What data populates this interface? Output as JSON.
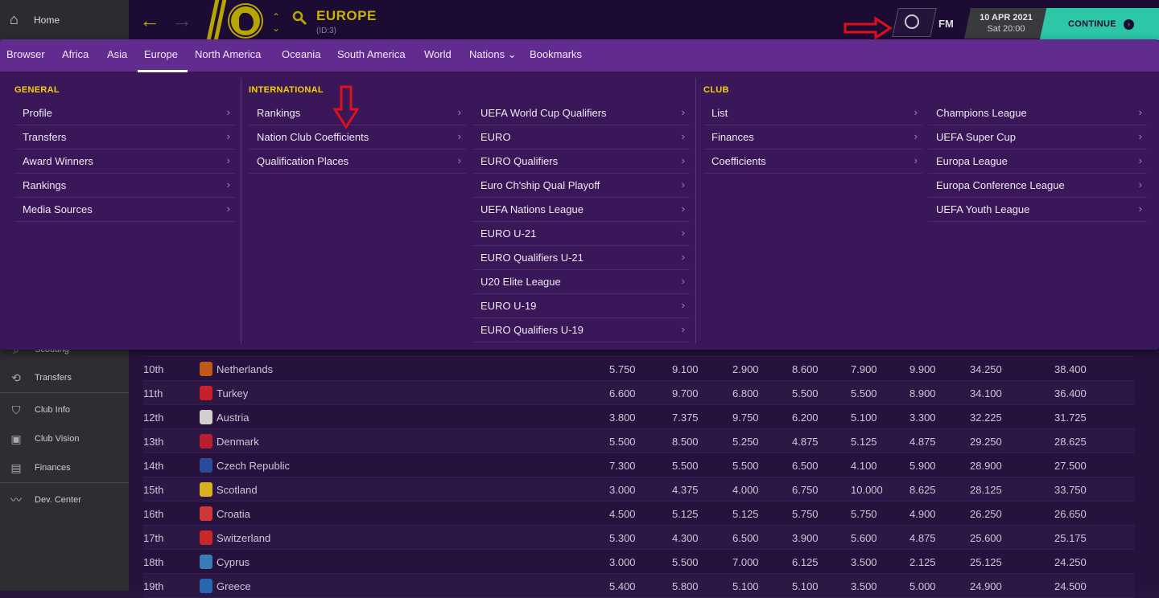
{
  "home": {
    "label": "Home",
    "icon": "home-icon"
  },
  "header": {
    "title": "EUROPE",
    "id_label": "(ID:3)",
    "fm_label": "FM",
    "date": "10 APR 2021",
    "time": "Sat 20:00",
    "continue_label": "CONTINUE"
  },
  "tabs": [
    {
      "label": "Browser"
    },
    {
      "label": "Africa"
    },
    {
      "label": "Asia"
    },
    {
      "label": "Europe",
      "active": true
    },
    {
      "label": "North America"
    },
    {
      "label": "Oceania"
    },
    {
      "label": "South America"
    },
    {
      "label": "World"
    },
    {
      "label": "Nations ⌄"
    },
    {
      "label": "Bookmarks"
    }
  ],
  "menu": {
    "general": {
      "heading": "GENERAL",
      "items": [
        "Profile",
        "Transfers",
        "Award Winners",
        "Rankings",
        "Media Sources"
      ]
    },
    "international": {
      "heading": "INTERNATIONAL",
      "items": [
        "Rankings",
        "Nation Club Coefficients",
        "Qualification Places"
      ]
    },
    "competitions": {
      "items": [
        "UEFA World Cup Qualifiers",
        "EURO",
        "EURO Qualifiers",
        "Euro Ch'ship Qual Playoff",
        "UEFA Nations League",
        "EURO U-21",
        "EURO Qualifiers U-21",
        "U20 Elite League",
        "EURO U-19",
        "EURO Qualifiers U-19"
      ]
    },
    "club": {
      "heading": "CLUB",
      "items": [
        "List",
        "Finances",
        "Coefficients"
      ]
    },
    "club_comps": {
      "items": [
        "Champions League",
        "UEFA Super Cup",
        "Europa League",
        "Europa Conference League",
        "UEFA Youth League"
      ]
    }
  },
  "sidebar": {
    "items": [
      {
        "label": "Scouting",
        "icon": "magnifier-icon"
      },
      {
        "label": "Transfers",
        "icon": "transfer-arrows-icon"
      },
      {
        "label": "Club Info",
        "icon": "shield-icon"
      },
      {
        "label": "Club Vision",
        "icon": "briefcase-icon"
      },
      {
        "label": "Finances",
        "icon": "banknote-icon"
      },
      {
        "label": "Dev. Center",
        "icon": "trend-line-icon"
      }
    ]
  },
  "table": {
    "rows": [
      {
        "rank": "10th",
        "nation": "Netherlands",
        "flag": "#c0581a",
        "values": [
          "5.750",
          "9.100",
          "2.900",
          "8.600",
          "7.900",
          "9.900",
          "34.250",
          "38.400"
        ]
      },
      {
        "rank": "11th",
        "nation": "Turkey",
        "flag": "#c8202a",
        "values": [
          "6.600",
          "9.700",
          "6.800",
          "5.500",
          "5.500",
          "8.900",
          "34.100",
          "36.400"
        ]
      },
      {
        "rank": "12th",
        "nation": "Austria",
        "flag": "#d0d0d0",
        "values": [
          "3.800",
          "7.375",
          "9.750",
          "6.200",
          "5.100",
          "3.300",
          "32.225",
          "31.725"
        ]
      },
      {
        "rank": "13th",
        "nation": "Denmark",
        "flag": "#b82030",
        "values": [
          "5.500",
          "8.500",
          "5.250",
          "4.875",
          "5.125",
          "4.875",
          "29.250",
          "28.625"
        ]
      },
      {
        "rank": "14th",
        "nation": "Czech Republic",
        "flag": "#2a4a9a",
        "values": [
          "7.300",
          "5.500",
          "5.500",
          "6.500",
          "4.100",
          "5.900",
          "28.900",
          "27.500"
        ]
      },
      {
        "rank": "15th",
        "nation": "Scotland",
        "flag": "#d8b020",
        "values": [
          "3.000",
          "4.375",
          "4.000",
          "6.750",
          "10.000",
          "8.625",
          "28.125",
          "33.750"
        ]
      },
      {
        "rank": "16th",
        "nation": "Croatia",
        "flag": "#d03838",
        "values": [
          "4.500",
          "5.125",
          "5.125",
          "5.750",
          "5.750",
          "4.900",
          "26.250",
          "26.650"
        ]
      },
      {
        "rank": "17th",
        "nation": "Switzerland",
        "flag": "#c82828",
        "values": [
          "5.300",
          "4.300",
          "6.500",
          "3.900",
          "5.600",
          "4.875",
          "25.600",
          "25.175"
        ]
      },
      {
        "rank": "18th",
        "nation": "Cyprus",
        "flag": "#3a7ab8",
        "values": [
          "3.000",
          "5.500",
          "7.000",
          "6.125",
          "3.500",
          "2.125",
          "25.125",
          "24.250"
        ]
      },
      {
        "rank": "19th",
        "nation": "Greece",
        "flag": "#2a66b0",
        "values": [
          "5.400",
          "5.800",
          "5.100",
          "5.100",
          "3.500",
          "5.000",
          "24.900",
          "24.500"
        ]
      }
    ]
  },
  "colors": {
    "accent": "#c8b400",
    "continue": "#2bc7a6",
    "tab_bar": "#622b8f",
    "menu_bg": "#3a1758",
    "heading": "#f6d200",
    "annotation": "#e0101a"
  }
}
